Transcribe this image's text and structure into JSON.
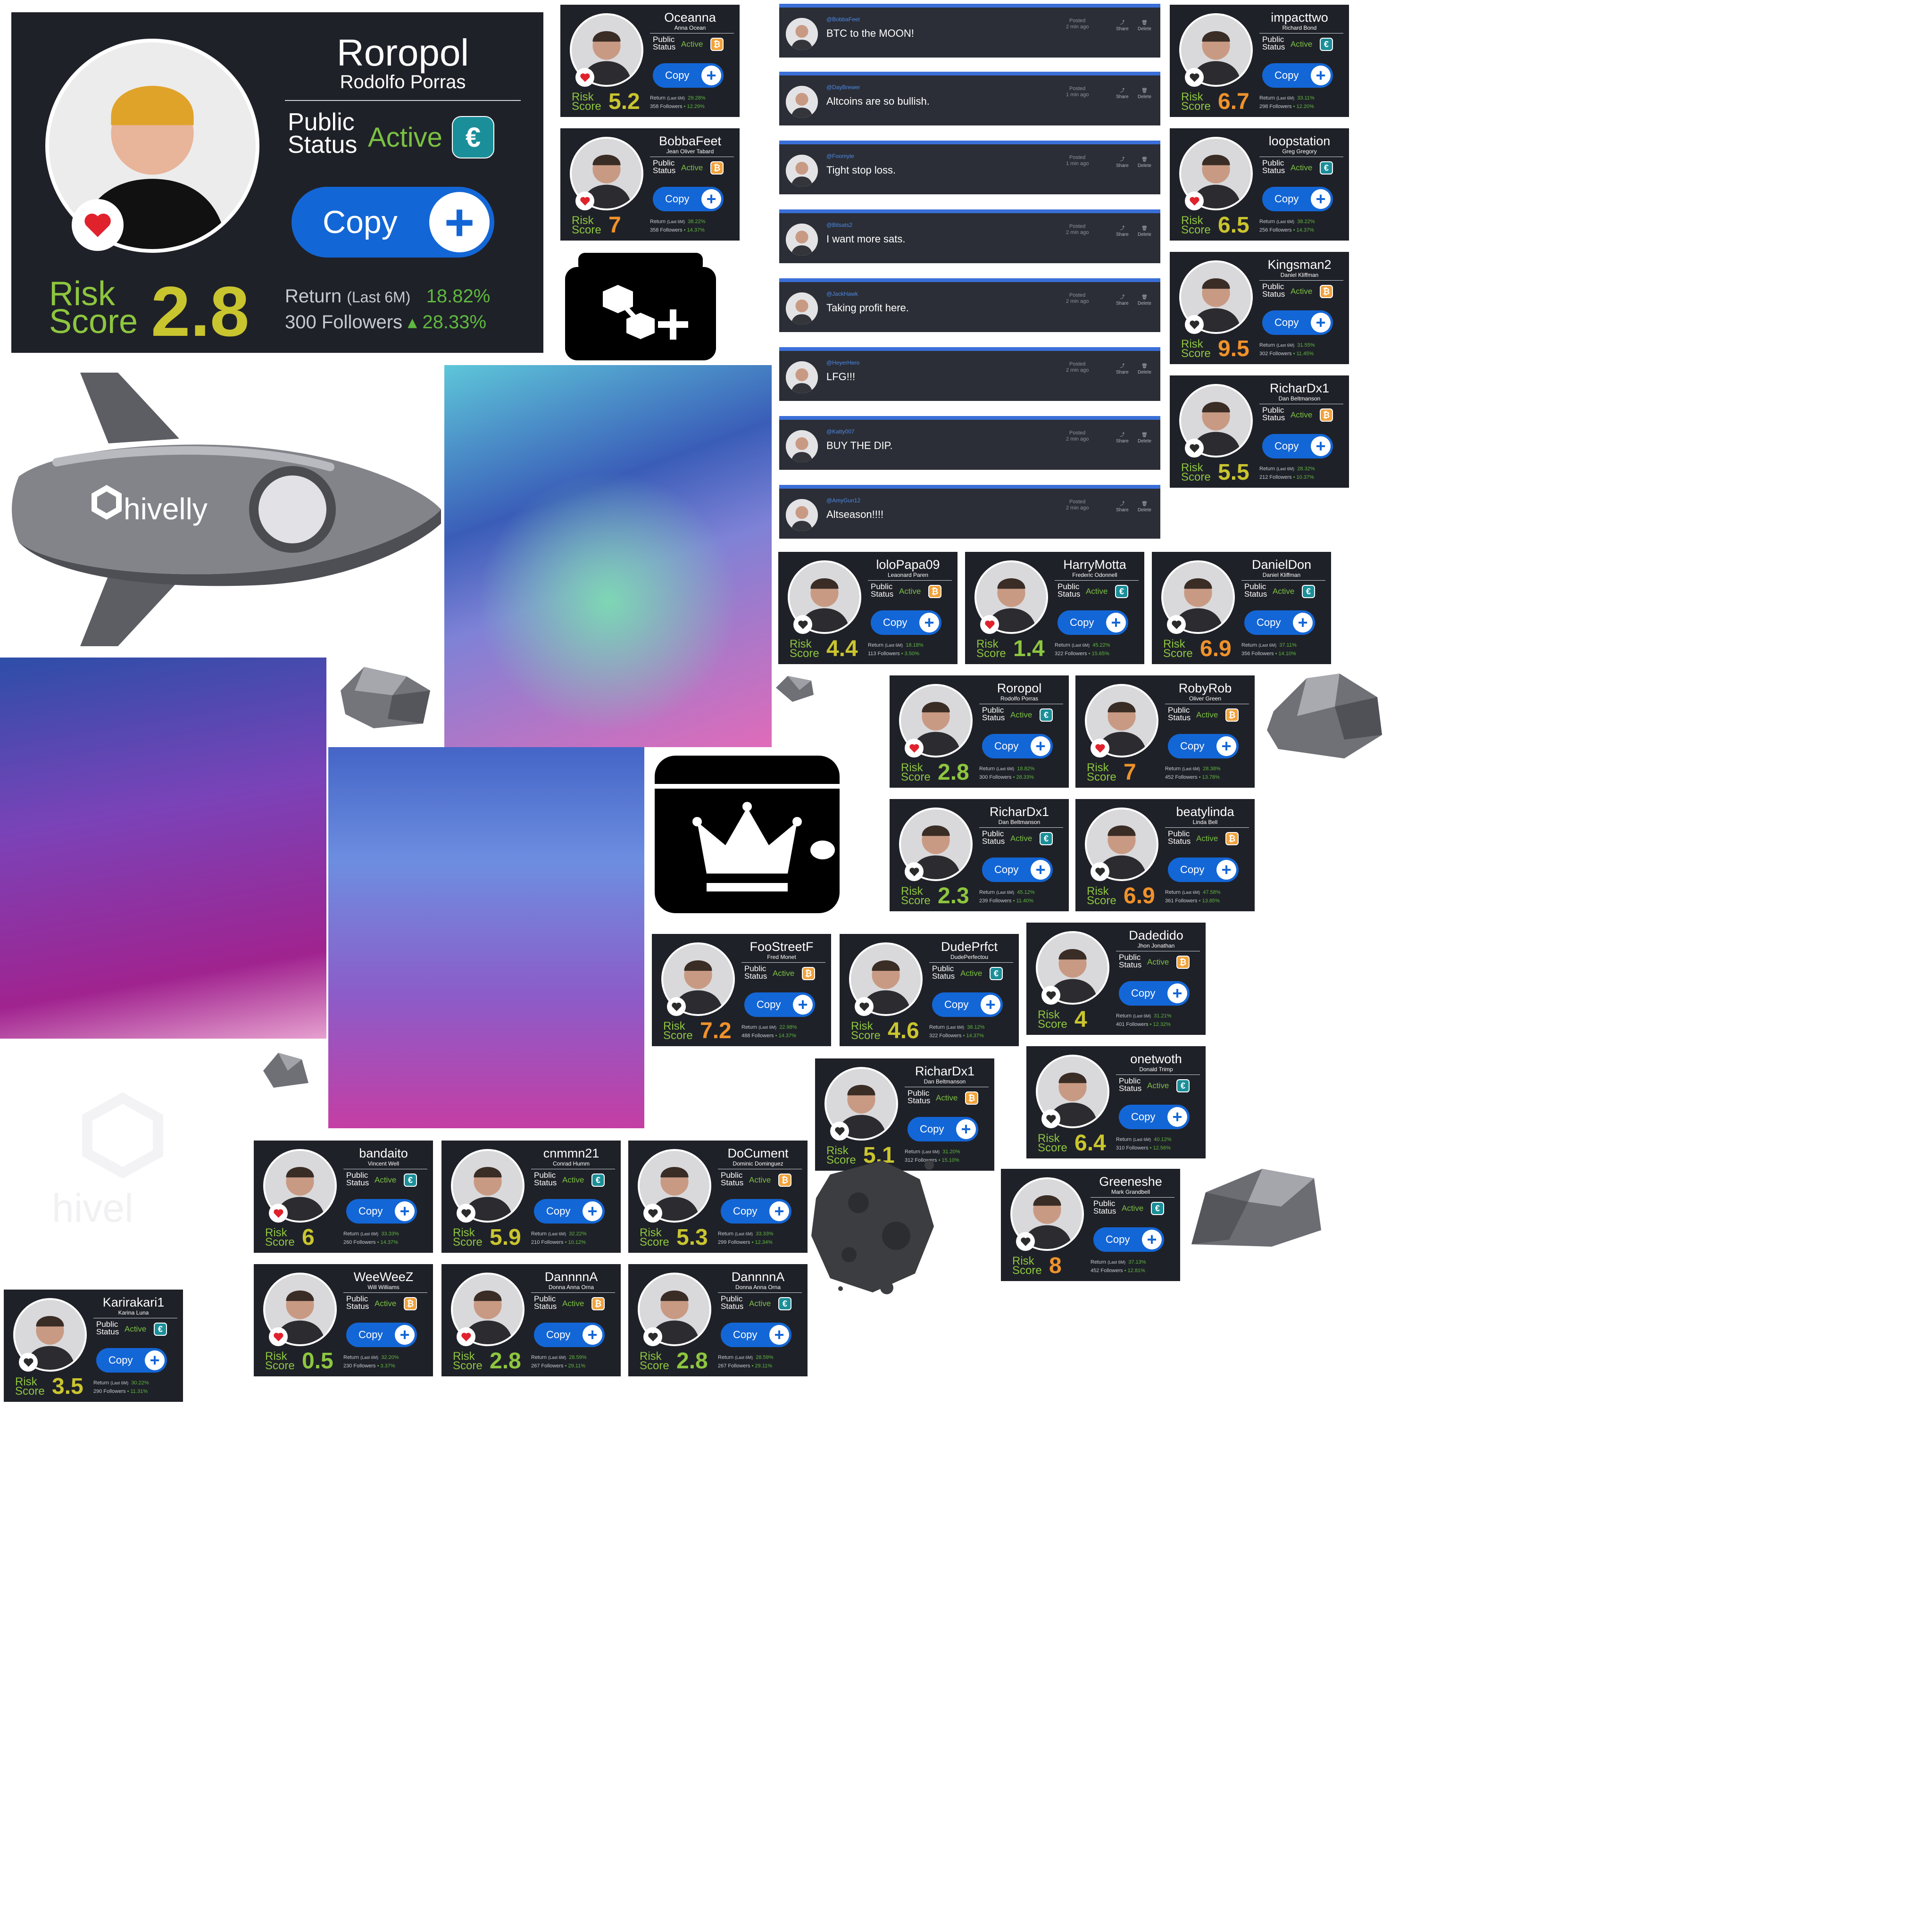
{
  "brand": {
    "name": "hivelly",
    "faded_name": "hivel"
  },
  "labels": {
    "public": "Public",
    "status": "Status",
    "active": "Active",
    "copy": "Copy",
    "risk": "Risk",
    "score": "Score",
    "return": "Return",
    "last6m": "(Last 6M)",
    "followers": "Followers",
    "posted": "Posted",
    "share": "Share",
    "delete": "Delete"
  },
  "colors": {
    "card_bg": "#1f2128",
    "copy_blue": "#1366d6",
    "active_green": "#7ac043",
    "risk_green": "#8dc63f",
    "risk_yellow": "#c9c52f",
    "risk_orange": "#f0922b",
    "post_accent": "#3a6fd8"
  },
  "featured": {
    "username": "Roropol",
    "real_name": "Rodolfo Porras",
    "currency": "euro-badge-icon",
    "risk": "2.8",
    "return": "18.82%",
    "followers": "300",
    "followers_change": "28.33%"
  },
  "cards": [
    {
      "username": "Oceanna",
      "real_name": "Anna Ocean",
      "risk": "5.2",
      "return": "29.28%",
      "followers": "358",
      "change": "12.29%",
      "currency": "btc",
      "liked": true
    },
    {
      "username": "BobbaFeet",
      "real_name": "Jean Oliver Tabard",
      "risk": "7",
      "return": "38.22%",
      "followers": "358",
      "change": "14.37%",
      "currency": "btc",
      "liked": true
    },
    {
      "username": "impacttwo",
      "real_name": "Richard Bond",
      "risk": "6.7",
      "return": "33.11%",
      "followers": "298",
      "change": "12.20%",
      "currency": "eur",
      "liked": false
    },
    {
      "username": "loopstation",
      "real_name": "Greg Gregory",
      "risk": "6.5",
      "return": "38.22%",
      "followers": "256",
      "change": "14.37%",
      "currency": "eur",
      "liked": true
    },
    {
      "username": "Kingsman2",
      "real_name": "Daniel Kliffman",
      "risk": "9.5",
      "return": "31.55%",
      "followers": "302",
      "change": "11.45%",
      "currency": "btc",
      "liked": false
    },
    {
      "username": "RicharDx1",
      "real_name": "Dan Beltmanson",
      "risk": "5.5",
      "return": "28.32%",
      "followers": "212",
      "change": "10.37%",
      "currency": "btc",
      "liked": false
    },
    {
      "username": "loloPapa09",
      "real_name": "Leaonard Paren",
      "risk": "4.4",
      "return": "18.18%",
      "followers": "113",
      "change": "3.50%",
      "currency": "btc",
      "liked": false
    },
    {
      "username": "HarryMotta",
      "real_name": "Frederic Odonnell",
      "risk": "1.4",
      "return": "45.22%",
      "followers": "322",
      "change": "15.65%",
      "currency": "eur",
      "liked": true
    },
    {
      "username": "DanielDon",
      "real_name": "Daniel Kliffman",
      "risk": "6.9",
      "return": "37.11%",
      "followers": "356",
      "change": "14.10%",
      "currency": "eur",
      "liked": false
    },
    {
      "username": "Roropol",
      "real_name": "Rodolfo Porras",
      "risk": "2.8",
      "return": "18.82%",
      "followers": "300",
      "change": "28.33%",
      "currency": "eur",
      "liked": true
    },
    {
      "username": "RobyRob",
      "real_name": "Oliver Green",
      "risk": "7",
      "return": "28.38%",
      "followers": "452",
      "change": "13.78%",
      "currency": "btc",
      "liked": true
    },
    {
      "username": "RicharDx1",
      "real_name": "Dan Beltmanson",
      "risk": "2.3",
      "return": "45.12%",
      "followers": "239",
      "change": "11.40%",
      "currency": "eur",
      "liked": false
    },
    {
      "username": "beatylinda",
      "real_name": "Linda Bell",
      "risk": "6.9",
      "return": "47.58%",
      "followers": "361",
      "change": "13.85%",
      "currency": "btc",
      "liked": false
    },
    {
      "username": "FooStreetF",
      "real_name": "Fred Monet",
      "risk": "7.2",
      "return": "22.98%",
      "followers": "488",
      "change": "14.37%",
      "currency": "btc",
      "liked": false
    },
    {
      "username": "DudePrfct",
      "real_name": "DudePerfectou",
      "risk": "4.6",
      "return": "38.12%",
      "followers": "322",
      "change": "14.37%",
      "currency": "eur",
      "liked": false
    },
    {
      "username": "Dadedido",
      "real_name": "Jhon Jonathan",
      "risk": "4",
      "return": "31.21%",
      "followers": "401",
      "change": "12.32%",
      "currency": "btc",
      "liked": false
    },
    {
      "username": "RicharDx1",
      "real_name": "Dan Beltmanson",
      "risk": "5.1",
      "return": "31.20%",
      "followers": "312",
      "change": "15.10%",
      "currency": "btc",
      "liked": false
    },
    {
      "username": "onetwoth",
      "real_name": "Donald Trimp",
      "risk": "6.4",
      "return": "40.12%",
      "followers": "310",
      "change": "12.56%",
      "currency": "eur",
      "liked": false
    },
    {
      "username": "Greeneshe",
      "real_name": "Mark Grandbell",
      "risk": "8",
      "return": "37.13%",
      "followers": "452",
      "change": "12.81%",
      "currency": "eur",
      "liked": false
    },
    {
      "username": "bandaito",
      "real_name": "Vincent Well",
      "risk": "6",
      "return": "33.33%",
      "followers": "260",
      "change": "14.37%",
      "currency": "eur",
      "liked": true
    },
    {
      "username": "cnmmn21",
      "real_name": "Conrad Humm",
      "risk": "5.9",
      "return": "32.22%",
      "followers": "210",
      "change": "10.12%",
      "currency": "eur",
      "liked": false
    },
    {
      "username": "DoCument",
      "real_name": "Dominic Dominguez",
      "risk": "5.3",
      "return": "33.33%",
      "followers": "299",
      "change": "12.34%",
      "currency": "btc",
      "liked": false
    },
    {
      "username": "WeeWeeZ",
      "real_name": "Will Williams",
      "risk": "0.5",
      "return": "32.20%",
      "followers": "230",
      "change": "3.37%",
      "currency": "btc",
      "liked": true
    },
    {
      "username": "DannnnA",
      "real_name": "Donna Anna Orna",
      "risk": "2.8",
      "return": "28.59%",
      "followers": "267",
      "change": "29.11%",
      "currency": "btc",
      "liked": true
    },
    {
      "username": "DannnnA",
      "real_name": "Donna Anna Orna",
      "risk": "2.8",
      "return": "28.59%",
      "followers": "267",
      "change": "29.11%",
      "currency": "eur",
      "liked": false
    },
    {
      "username": "Karirakari1",
      "real_name": "Karina Luna",
      "risk": "3.5",
      "return": "30.22%",
      "followers": "290",
      "change": "11.31%",
      "currency": "eur",
      "liked": false
    }
  ],
  "posts": [
    {
      "handle": "@BobbaFeet",
      "message": "BTC to the MOON!",
      "posted": "2 min ago"
    },
    {
      "handle": "@DayBrewer",
      "message": "Altcoins are so bullish.",
      "posted": "1 min ago"
    },
    {
      "handle": "@Foomyte",
      "message": "Tight stop loss.",
      "posted": "1 min ago"
    },
    {
      "handle": "@Bitsats2",
      "message": "I want more sats.",
      "posted": "2 min ago"
    },
    {
      "handle": "@JackHawk",
      "message": "Taking profit here.",
      "posted": "2 min ago"
    },
    {
      "handle": "@HeyerHero",
      "message": "LFG!!!",
      "posted": "2 min ago"
    },
    {
      "handle": "@Katty007",
      "message": "BUY THE DIP.",
      "posted": "2 min ago"
    },
    {
      "handle": "@AmyGun12",
      "message": "Altseason!!!!",
      "posted": "2 min ago"
    }
  ],
  "icons": [
    "add-network-card-icon",
    "crown-card-icon",
    "rocket-icon",
    "heart-icon",
    "plus-icon",
    "euro-badge-icon",
    "bitcoin-badge-icon",
    "share-icon",
    "delete-icon"
  ]
}
